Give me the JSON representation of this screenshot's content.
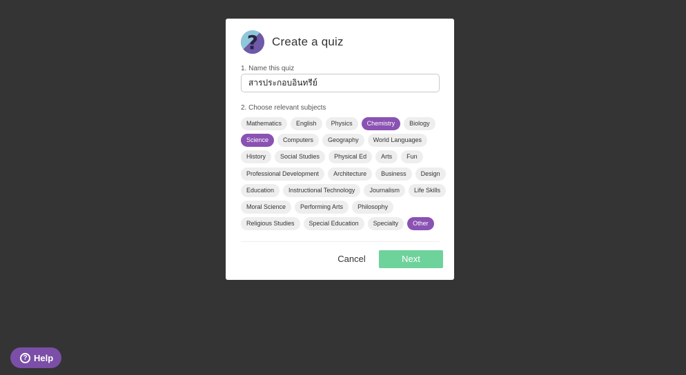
{
  "modal": {
    "title": "Create a quiz",
    "logo_icon": "question-mark-icon",
    "logo_glyph": "?",
    "name_label": "1. Name this quiz",
    "name_value": "สารประกอบอินทรีย์",
    "subjects_label": "2. Choose relevant subjects",
    "subject_rows": [
      [
        {
          "label": "Mathematics",
          "selected": false
        },
        {
          "label": "English",
          "selected": false
        },
        {
          "label": "Physics",
          "selected": false
        },
        {
          "label": "Chemistry",
          "selected": true
        },
        {
          "label": "Biology",
          "selected": false
        }
      ],
      [
        {
          "label": "Science",
          "selected": true
        },
        {
          "label": "Computers",
          "selected": false
        },
        {
          "label": "Geography",
          "selected": false
        },
        {
          "label": "World Languages",
          "selected": false
        }
      ],
      [
        {
          "label": "History",
          "selected": false
        },
        {
          "label": "Social Studies",
          "selected": false
        },
        {
          "label": "Physical Ed",
          "selected": false
        },
        {
          "label": "Arts",
          "selected": false
        },
        {
          "label": "Fun",
          "selected": false
        }
      ],
      [
        {
          "label": "Professional Development",
          "selected": false
        },
        {
          "label": "Architecture",
          "selected": false
        },
        {
          "label": "Business",
          "selected": false
        },
        {
          "label": "Design",
          "selected": false
        }
      ],
      [
        {
          "label": "Education",
          "selected": false
        },
        {
          "label": "Instructional Technology",
          "selected": false
        },
        {
          "label": "Journalism",
          "selected": false
        },
        {
          "label": "Life Skills",
          "selected": false
        }
      ],
      [
        {
          "label": "Moral Science",
          "selected": false
        },
        {
          "label": "Performing Arts",
          "selected": false
        },
        {
          "label": "Philosophy",
          "selected": false
        }
      ],
      [
        {
          "label": "Religious Studies",
          "selected": false
        },
        {
          "label": "Special Education",
          "selected": false
        },
        {
          "label": "Specialty",
          "selected": false
        },
        {
          "label": "Other",
          "selected": true
        }
      ]
    ],
    "cancel_label": "Cancel",
    "next_label": "Next"
  },
  "help": {
    "label": "Help",
    "icon": "help-circle-icon",
    "icon_glyph": "?"
  },
  "colors": {
    "background": "#343434",
    "selected_chip": "#8a52b3",
    "next_button": "#6ed29b",
    "help_button": "#7b4ea7"
  }
}
